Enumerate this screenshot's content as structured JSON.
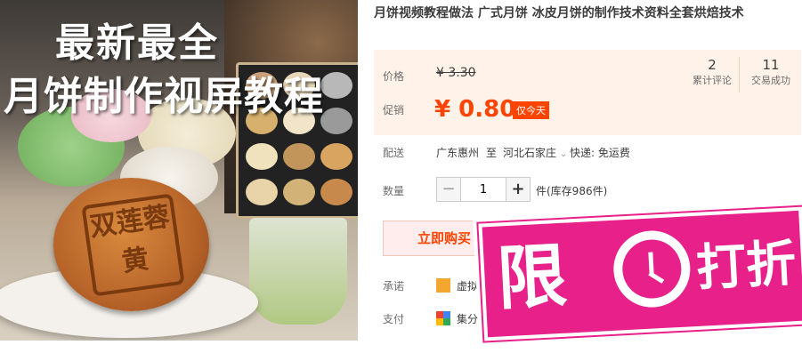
{
  "hero": {
    "title_line1": "最新最全",
    "title_line2": "月饼制作视屏教程",
    "cake_stamp_chars": "双莲蓉黄"
  },
  "product": {
    "title": "月饼视频教程做法 广式月饼 冰皮月饼的制作技术资料全套烘焙技术"
  },
  "price": {
    "label": "价格",
    "old": "¥ 3.30",
    "promo_label": "促销",
    "new": "¥ 0.80",
    "tag": "仅今天",
    "reviews_count": "2",
    "reviews_label": "累计评论",
    "trades_count": "11",
    "trades_label": "交易成功"
  },
  "delivery": {
    "label": "配送",
    "from": "广东惠州",
    "to_word": "至",
    "destination": "河北石家庄",
    "shipping": "快递: 免运费"
  },
  "quantity": {
    "label": "数量",
    "value": "1",
    "minus": "−",
    "plus": "+",
    "stock": "件(库存986件)"
  },
  "buy_button": "立即购买",
  "promise": {
    "label": "承诺",
    "text": "虚拟"
  },
  "payment": {
    "label": "支付",
    "text": "集分"
  },
  "sticker": {
    "char1": "限",
    "char2": "打折"
  },
  "colors": {
    "accent": "#ff4400",
    "price_bg": "#fff2e8",
    "sticker": "#e8208a"
  }
}
